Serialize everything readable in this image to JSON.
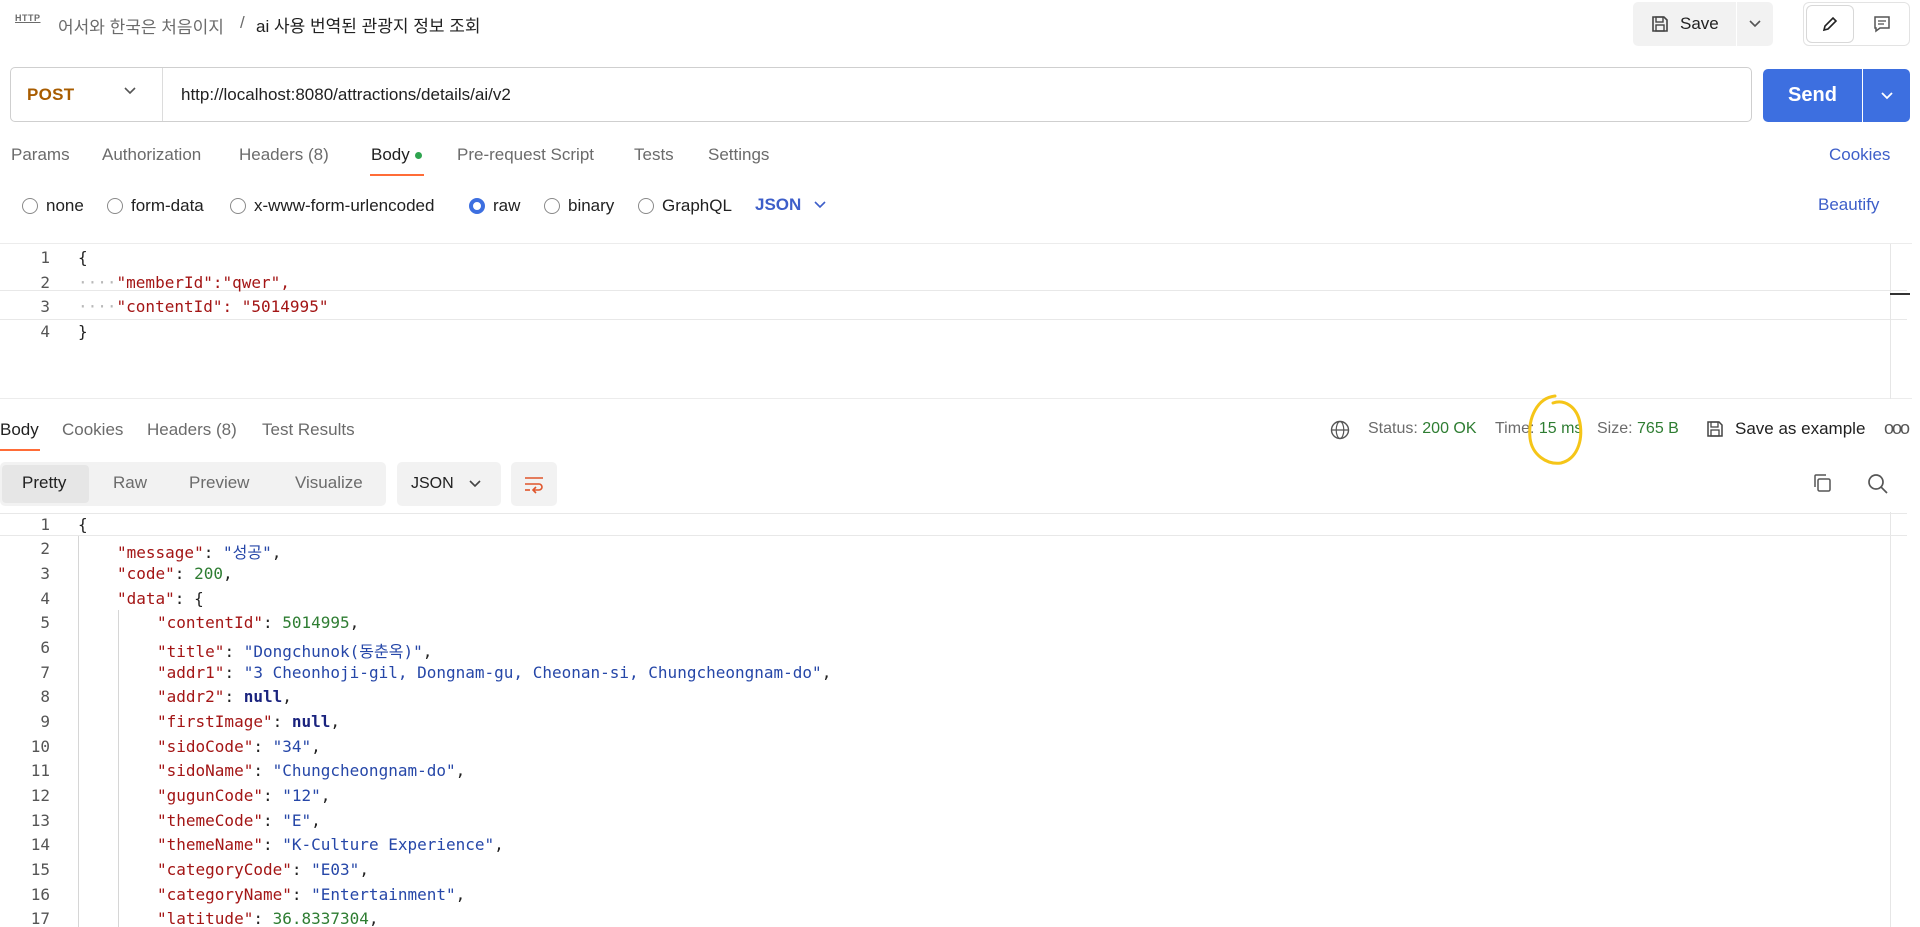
{
  "header": {
    "http_icon_text": "HTTP",
    "breadcrumb_parent": "어서와 한국은 처음이지",
    "breadcrumb_separator": "/",
    "request_name": "ai 사용 번역된 관광지 정보 조회",
    "save_label": "Save"
  },
  "request": {
    "method": "POST",
    "url": "http://localhost:8080/attractions/details/ai/v2",
    "send_label": "Send",
    "tabs": [
      {
        "label": "Params"
      },
      {
        "label": "Authorization"
      },
      {
        "label": "Headers (8)"
      },
      {
        "label": "Body",
        "active": true
      },
      {
        "label": "Pre-request Script"
      },
      {
        "label": "Tests"
      },
      {
        "label": "Settings"
      }
    ],
    "cookies_label": "Cookies",
    "body_types": [
      {
        "label": "none"
      },
      {
        "label": "form-data"
      },
      {
        "label": "x-www-form-urlencoded"
      },
      {
        "label": "raw",
        "selected": true
      },
      {
        "label": "binary"
      },
      {
        "label": "GraphQL"
      }
    ],
    "body_format": "JSON",
    "beautify_label": "Beautify",
    "body_lines": [
      "{",
      "\"memberId\":\"qwer\",",
      "\"contentId\": \"5014995\"",
      "}"
    ]
  },
  "response": {
    "tabs": [
      {
        "label": "Body",
        "active": true
      },
      {
        "label": "Cookies"
      },
      {
        "label": "Headers (8)"
      },
      {
        "label": "Test Results"
      }
    ],
    "status_label": "Status:",
    "status_value": "200 OK",
    "time_label": "Time:",
    "time_value": "15 ms",
    "size_label": "Size:",
    "size_value": "765 B",
    "save_example_label": "Save as example",
    "view_modes": [
      "Pretty",
      "Raw",
      "Preview",
      "Visualize"
    ],
    "format": "JSON",
    "line_numbers": [
      "1",
      "2",
      "3",
      "4",
      "5",
      "6",
      "7",
      "8",
      "9",
      "10",
      "11",
      "12",
      "13",
      "14",
      "15",
      "16",
      "17"
    ],
    "body": {
      "message": "성공",
      "code": 200,
      "contentId": 5014995,
      "title": "Dongchunok(동춘옥)",
      "addr1": "3 Cheonhoji-gil, Dongnam-gu, Cheonan-si, Chungcheongnam-do",
      "addr2": "null",
      "firstImage": "null",
      "sidoCode": "34",
      "sidoName": "Chungcheongnam-do",
      "gugunCode": "12",
      "themeCode": "E",
      "themeName": "K-Culture Experience",
      "categoryCode": "E03",
      "categoryName": "Entertainment",
      "latitude": "36.8337304"
    }
  },
  "colors": {
    "accent_blue": "#3d6fe0",
    "tab_underline": "#ff6c37",
    "method_post": "#a85c00",
    "status_green": "#2e7d32",
    "annotation_yellow": "#f5c518"
  }
}
